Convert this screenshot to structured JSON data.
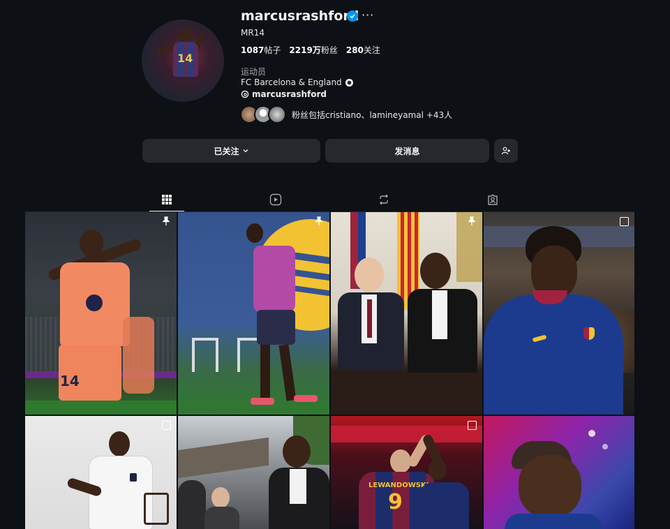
{
  "profile": {
    "username": "marcusrashford",
    "full_name": "MR14",
    "stats": {
      "posts_count": "1087",
      "posts_label": "帖子",
      "followers_count": "2219万",
      "followers_label": "粉丝",
      "following_count": "280",
      "following_label": "关注"
    },
    "category": "运动员",
    "bio": "FC Barcelona & England",
    "threads_handle": "marcusrashford",
    "followed_by_text": "粉丝包括cristiano、lamineyamal +43人",
    "avatar_jersey_number": "14"
  },
  "actions": {
    "following_label": "已关注",
    "message_label": "发消息"
  },
  "tabs": [
    {
      "name": "posts",
      "icon": "grid-icon",
      "active": true
    },
    {
      "name": "reels",
      "icon": "reels-icon",
      "active": false
    },
    {
      "name": "reposts",
      "icon": "repost-icon",
      "active": false
    },
    {
      "name": "tagged",
      "icon": "tagged-icon",
      "active": false
    }
  ],
  "posts": [
    {
      "pinned": true,
      "multi": false,
      "jersey_number": "14"
    },
    {
      "pinned": true,
      "multi": false
    },
    {
      "pinned": true,
      "multi": false
    },
    {
      "pinned": false,
      "multi": true
    },
    {
      "pinned": false,
      "multi": true
    },
    {
      "pinned": false,
      "multi": false
    },
    {
      "pinned": false,
      "multi": true,
      "jersey_name": "LEWANDOWSKI",
      "jersey_number": "9"
    },
    {
      "pinned": false,
      "multi": false
    }
  ],
  "colors": {
    "background": "#0d1014",
    "button": "#25292e",
    "verified": "#0095f6",
    "barca_blue": "#1b3f8e",
    "barca_orange": "#f18a63"
  }
}
